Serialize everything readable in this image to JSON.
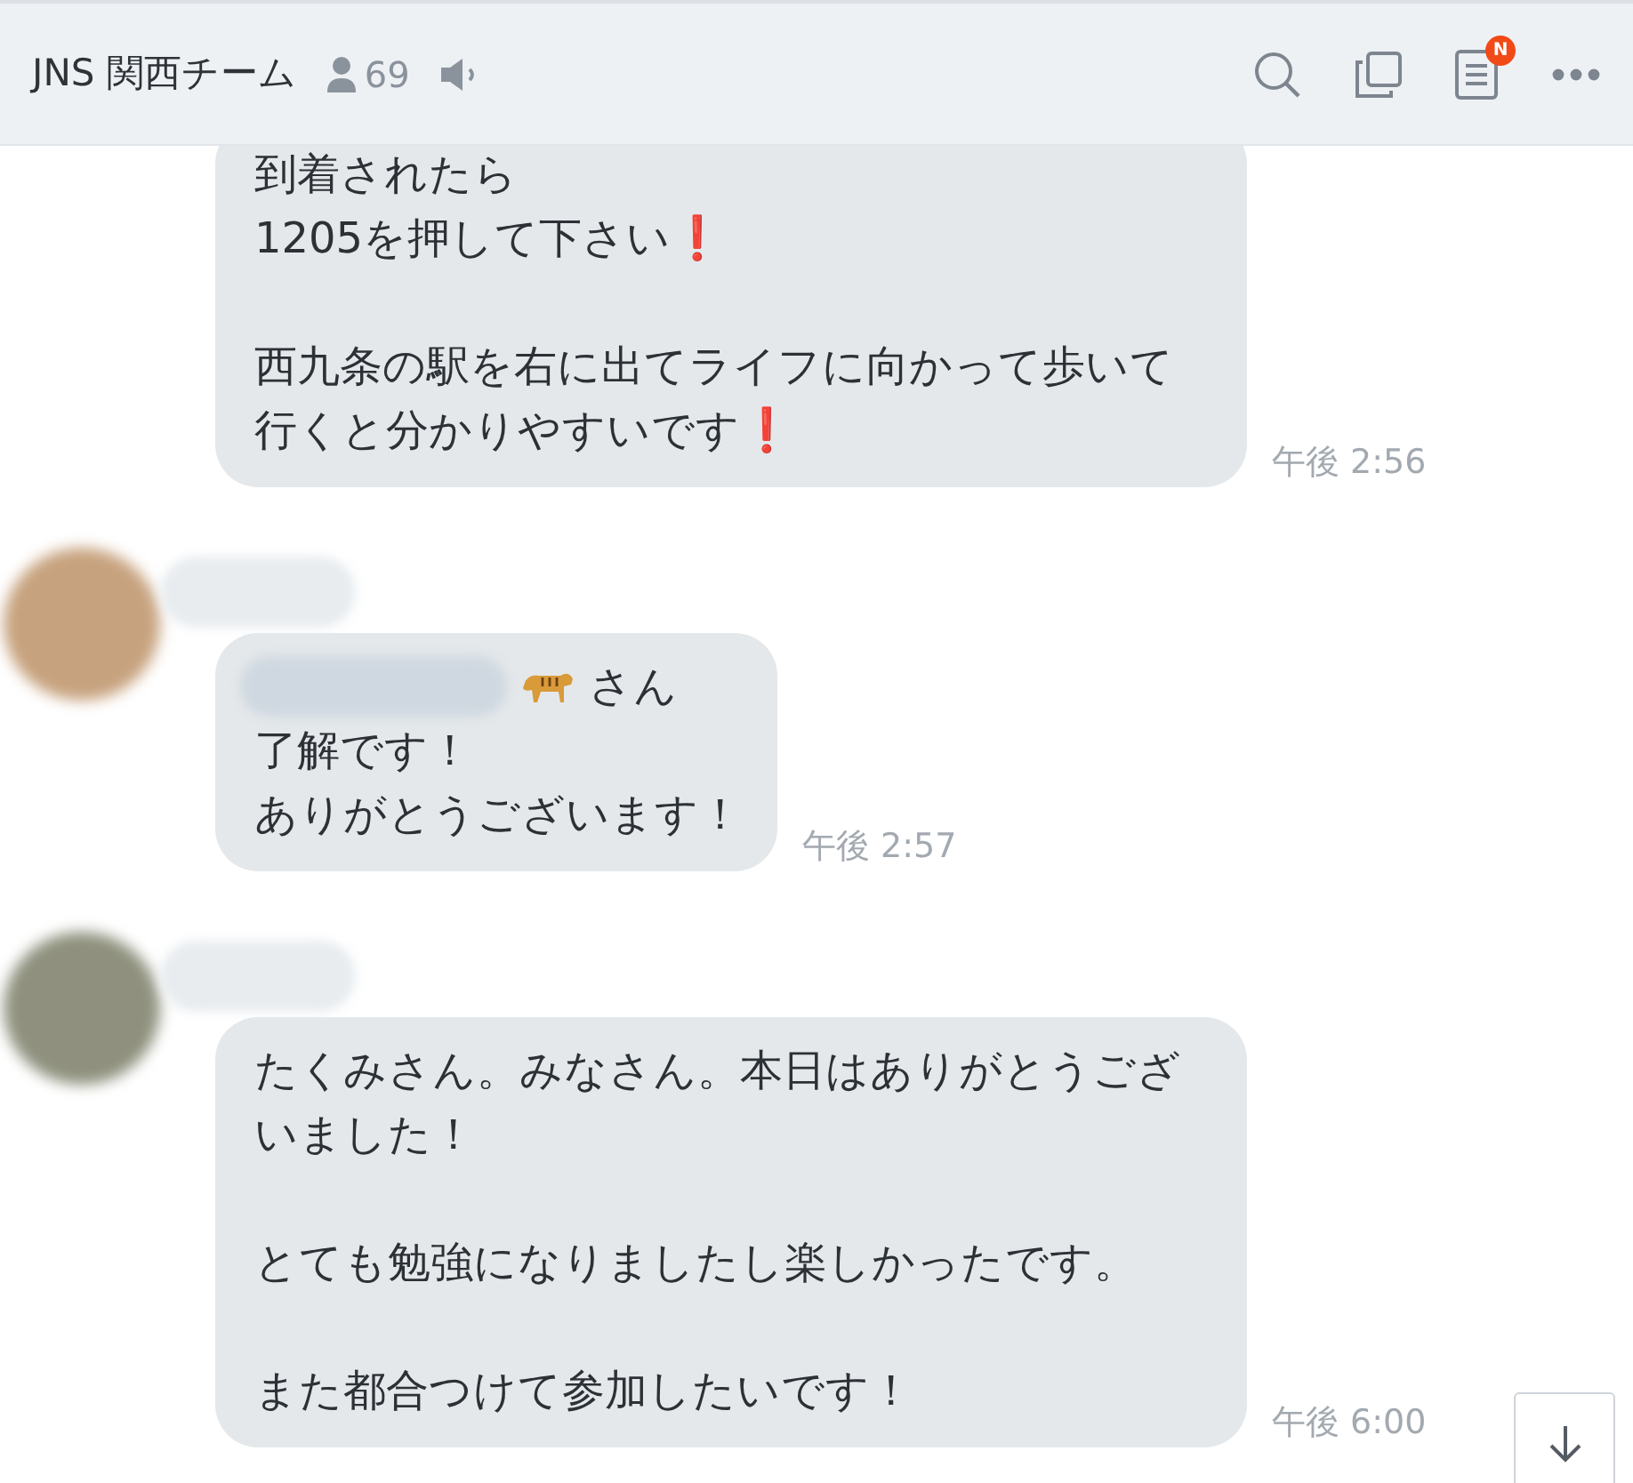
{
  "header": {
    "title": "JNS 関西チーム",
    "member_count": "69",
    "notes_badge": "N"
  },
  "messages": [
    {
      "show_avatar": false,
      "paragraphs": [
        [
          "到着されたら",
          "1205を押して下さい❗"
        ],
        [
          "西九条の駅を右に出てライフに向かって歩いて行くと分かりやすいです❗"
        ]
      ],
      "time": "午後 2:56"
    },
    {
      "show_avatar": true,
      "mention": "さん",
      "paragraphs": [
        [
          "了解です！",
          "ありがとうございます！"
        ]
      ],
      "time": "午後 2:57"
    },
    {
      "show_avatar": true,
      "paragraphs": [
        [
          "たくみさん。みなさん。本日はありがとうございました！"
        ],
        [
          "とても勉強になりましたし楽しかったです。"
        ],
        [
          "また都合つけて参加したいです！"
        ]
      ],
      "time": "午後 6:00"
    }
  ]
}
